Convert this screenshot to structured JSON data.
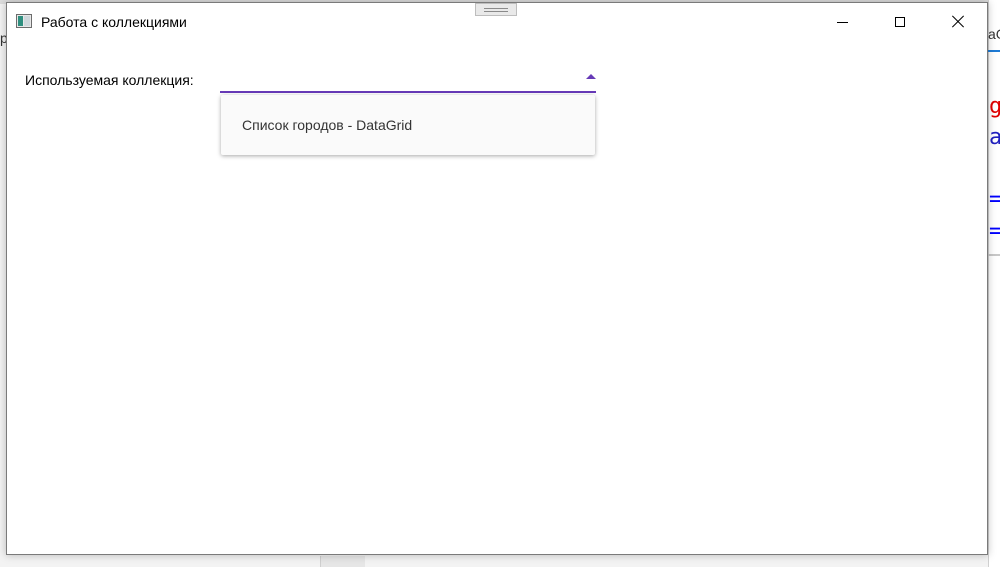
{
  "background": {
    "right_tab_label": "аG",
    "code_fragments": [
      "g",
      "a",
      "=",
      "="
    ],
    "left_fragment": "р"
  },
  "window": {
    "title": "Работа с коллекциями",
    "controls": {
      "minimize": "minimize-icon",
      "maximize": "maximize-icon",
      "close": "close-icon"
    }
  },
  "form": {
    "collection_label": "Используемая коллекция:",
    "collection_value": "",
    "dropdown_items": [
      "Список городов - DataGrid"
    ]
  },
  "colors": {
    "accent": "#673ab7"
  }
}
